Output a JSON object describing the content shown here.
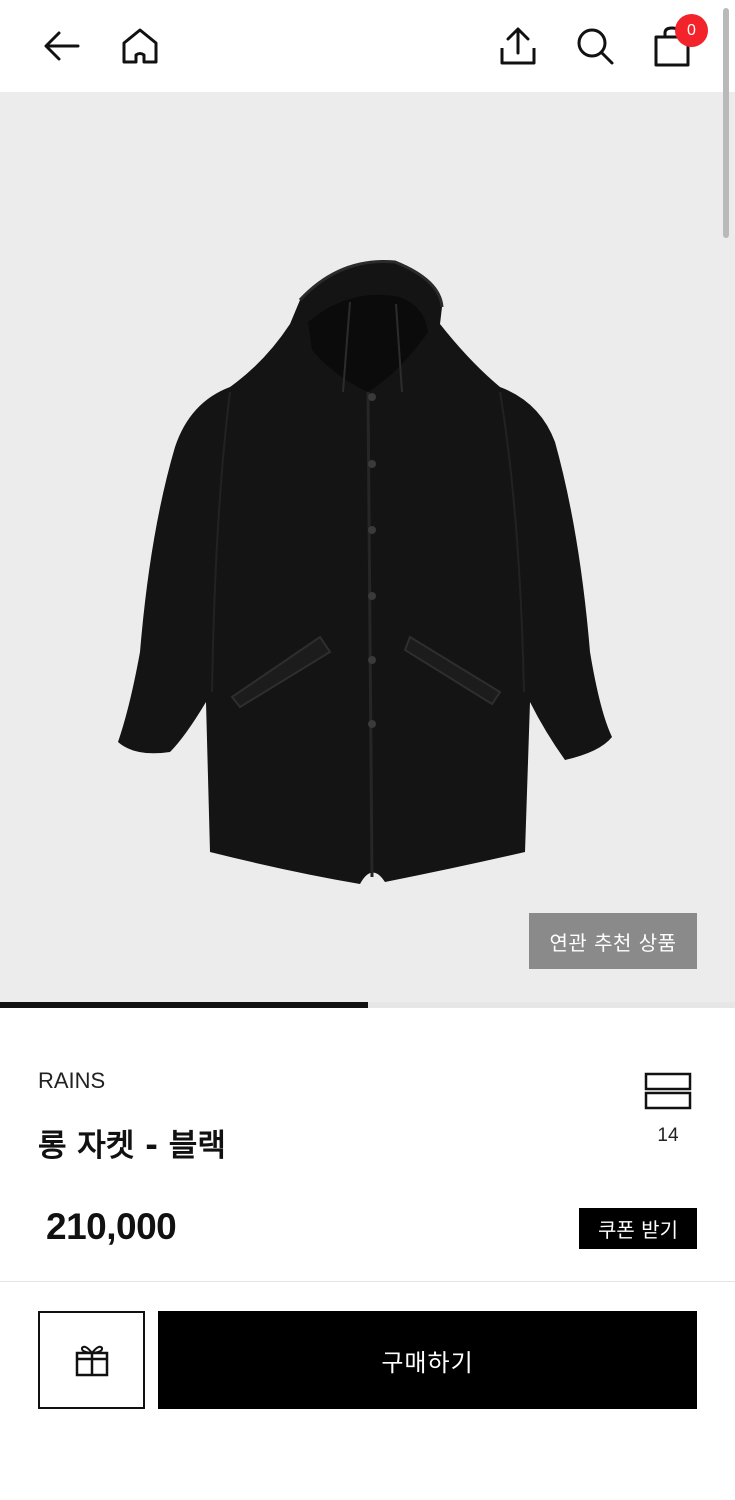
{
  "header": {
    "back_icon": "arrow-left-icon",
    "home_icon": "home-icon",
    "share_icon": "share-upload-icon",
    "search_icon": "search-icon",
    "cart_icon": "shopping-bag-icon",
    "cart_count": "0",
    "badge_color": "#f2232a"
  },
  "gallery": {
    "image_subject": "black long hooded rain jacket",
    "related_button_label": "연관 추천 상품",
    "progress_fraction": 0.5
  },
  "product": {
    "brand": "RAINS",
    "name": "롱 자켓 - 블랙",
    "wish_icon": "wishlist-icon",
    "wish_count": "14",
    "price": "210,000",
    "coupon_button_label": "쿠폰 받기"
  },
  "actions": {
    "gift_icon": "gift-icon",
    "buy_button_label": "구매하기"
  }
}
